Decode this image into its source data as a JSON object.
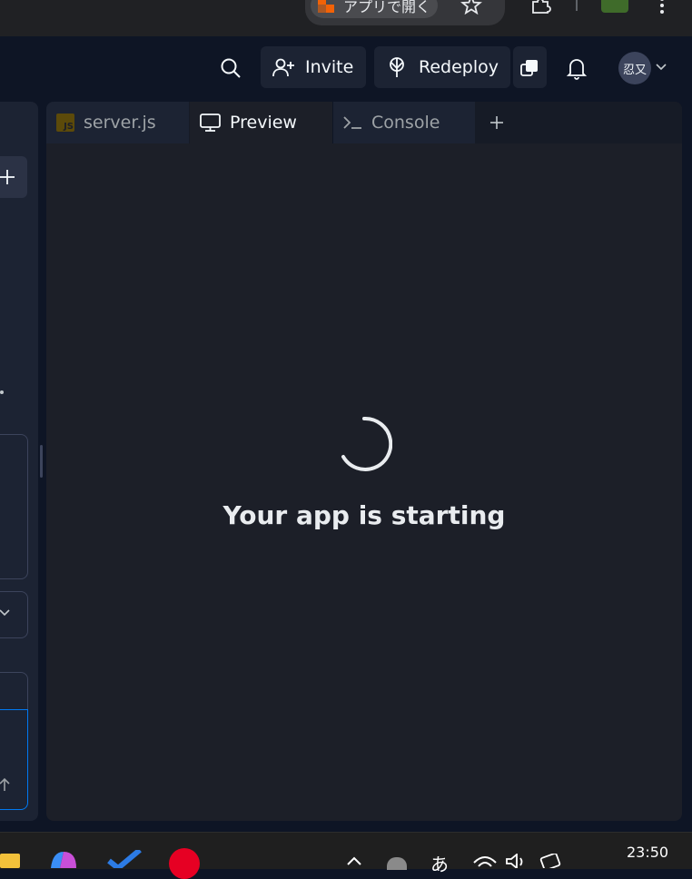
{
  "browser": {
    "open_in_app_label": "アプリで開く",
    "icons": [
      "bookmark-star-icon",
      "extensions-icon",
      "profile-icon",
      "more-vert-icon"
    ]
  },
  "header": {
    "invite_label": "Invite",
    "redeploy_label": "Redeploy",
    "avatar_text": "忍又"
  },
  "tabs": [
    {
      "label": "server.js",
      "icon": "js-file-icon",
      "active": false
    },
    {
      "label": "Preview",
      "icon": "monitor-icon",
      "active": true
    },
    {
      "label": "Console",
      "icon": "terminal-icon",
      "active": false
    }
  ],
  "preview": {
    "status_text": "Your app is starting"
  },
  "taskbar": {
    "ime_label": "あ",
    "clock": "23:50"
  },
  "colors": {
    "background": "#0e1525",
    "surface": "#1c2333",
    "preview_bg": "#1c1f28",
    "text": "#f5f9fc",
    "dim_text": "#9da2a6"
  }
}
